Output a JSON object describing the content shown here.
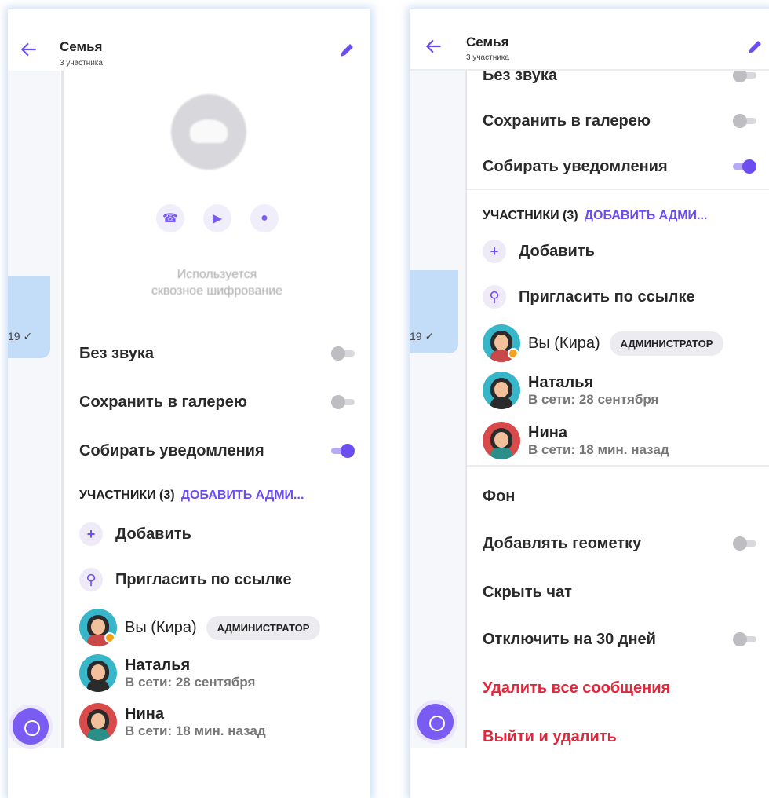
{
  "header": {
    "title": "Семья",
    "subtitle": "3 участника"
  },
  "chat": {
    "time": "19"
  },
  "group": {
    "encryption_line1": "Используется",
    "encryption_line2": "сквозное шифрование"
  },
  "settings": {
    "mute": {
      "label": "Без звука",
      "on": false
    },
    "save_gallery": {
      "label": "Сохранить в галерею",
      "on": false
    },
    "collect_notifications": {
      "label": "Собирать уведомления",
      "on": true
    }
  },
  "members_section": {
    "title": "УЧАСТНИКИ (3)",
    "add_admin": "ДОБАВИТЬ АДМИ...",
    "add": "Добавить",
    "invite": "Пригласить по ссылке"
  },
  "members": [
    {
      "name": "Вы (Кира)",
      "badge": "АДМИНИСТРАТОР"
    },
    {
      "name": "Наталья",
      "status": "В сети: 28 сентября"
    },
    {
      "name": "Нина",
      "status": "В сети: 18 мин. назад"
    }
  ],
  "more": {
    "background": "Фон",
    "geotag": {
      "label": "Добавлять геометку",
      "on": false
    },
    "hide_chat": "Скрыть чат",
    "mute_30": {
      "label": "Отключить на 30 дней",
      "on": false
    },
    "delete_all": "Удалить все сообщения",
    "leave_delete": "Выйти и удалить"
  },
  "colors": {
    "accent": "#6c4df0",
    "danger": "#e0283c",
    "bubble": "#c3dcf7"
  }
}
